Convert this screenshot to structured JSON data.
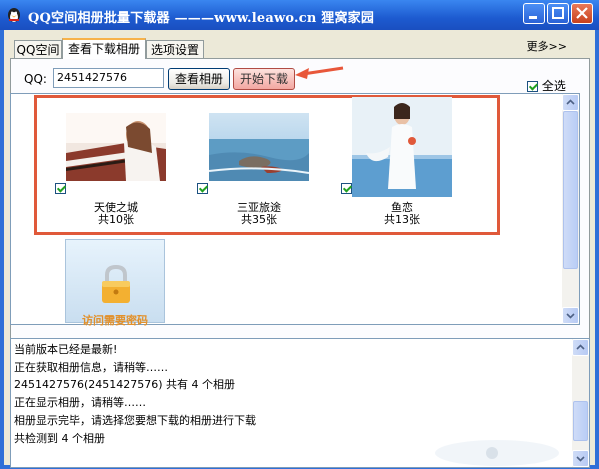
{
  "window": {
    "title": "QQ空间相册批量下载器 ———www.leawo.cn 狸窝家园",
    "more": "更多>>"
  },
  "tabs": [
    {
      "label": "QQ空间",
      "active": false
    },
    {
      "label": "查看下载相册",
      "active": true
    },
    {
      "label": "选项设置",
      "active": false
    }
  ],
  "toolbar": {
    "qq_label": "QQ:",
    "qq_value": "2451427576",
    "view_label": "查看相册",
    "start_label": "开始下载",
    "select_all": "全选"
  },
  "albums": [
    {
      "name": "天使之城",
      "count": "共10张",
      "checked": true,
      "icon": "album-photo-woman-piano"
    },
    {
      "name": "三亚旅途",
      "count": "共35张",
      "checked": true,
      "icon": "album-photo-sea-rocks"
    },
    {
      "name": "鱼恋",
      "count": "共13张",
      "checked": true,
      "icon": "album-photo-woman-beach"
    }
  ],
  "locked_album": {
    "label": "访问需要密码",
    "icon": "padlock-icon"
  },
  "log": [
    "当前版本已经是最新!",
    "正在获取相册信息，请稍等……",
    "2451427576(2451427576) 共有 4 个相册",
    "正在显示相册，请稍等……",
    "相册显示完毕，请选择您要想下载的相册进行下载",
    "共检测到 4 个相册"
  ],
  "colors": {
    "title_bar": "#1d5bd0",
    "highlight": "#e0593a",
    "start_button": "#f3a7a1",
    "lock_label": "#e2902a"
  }
}
